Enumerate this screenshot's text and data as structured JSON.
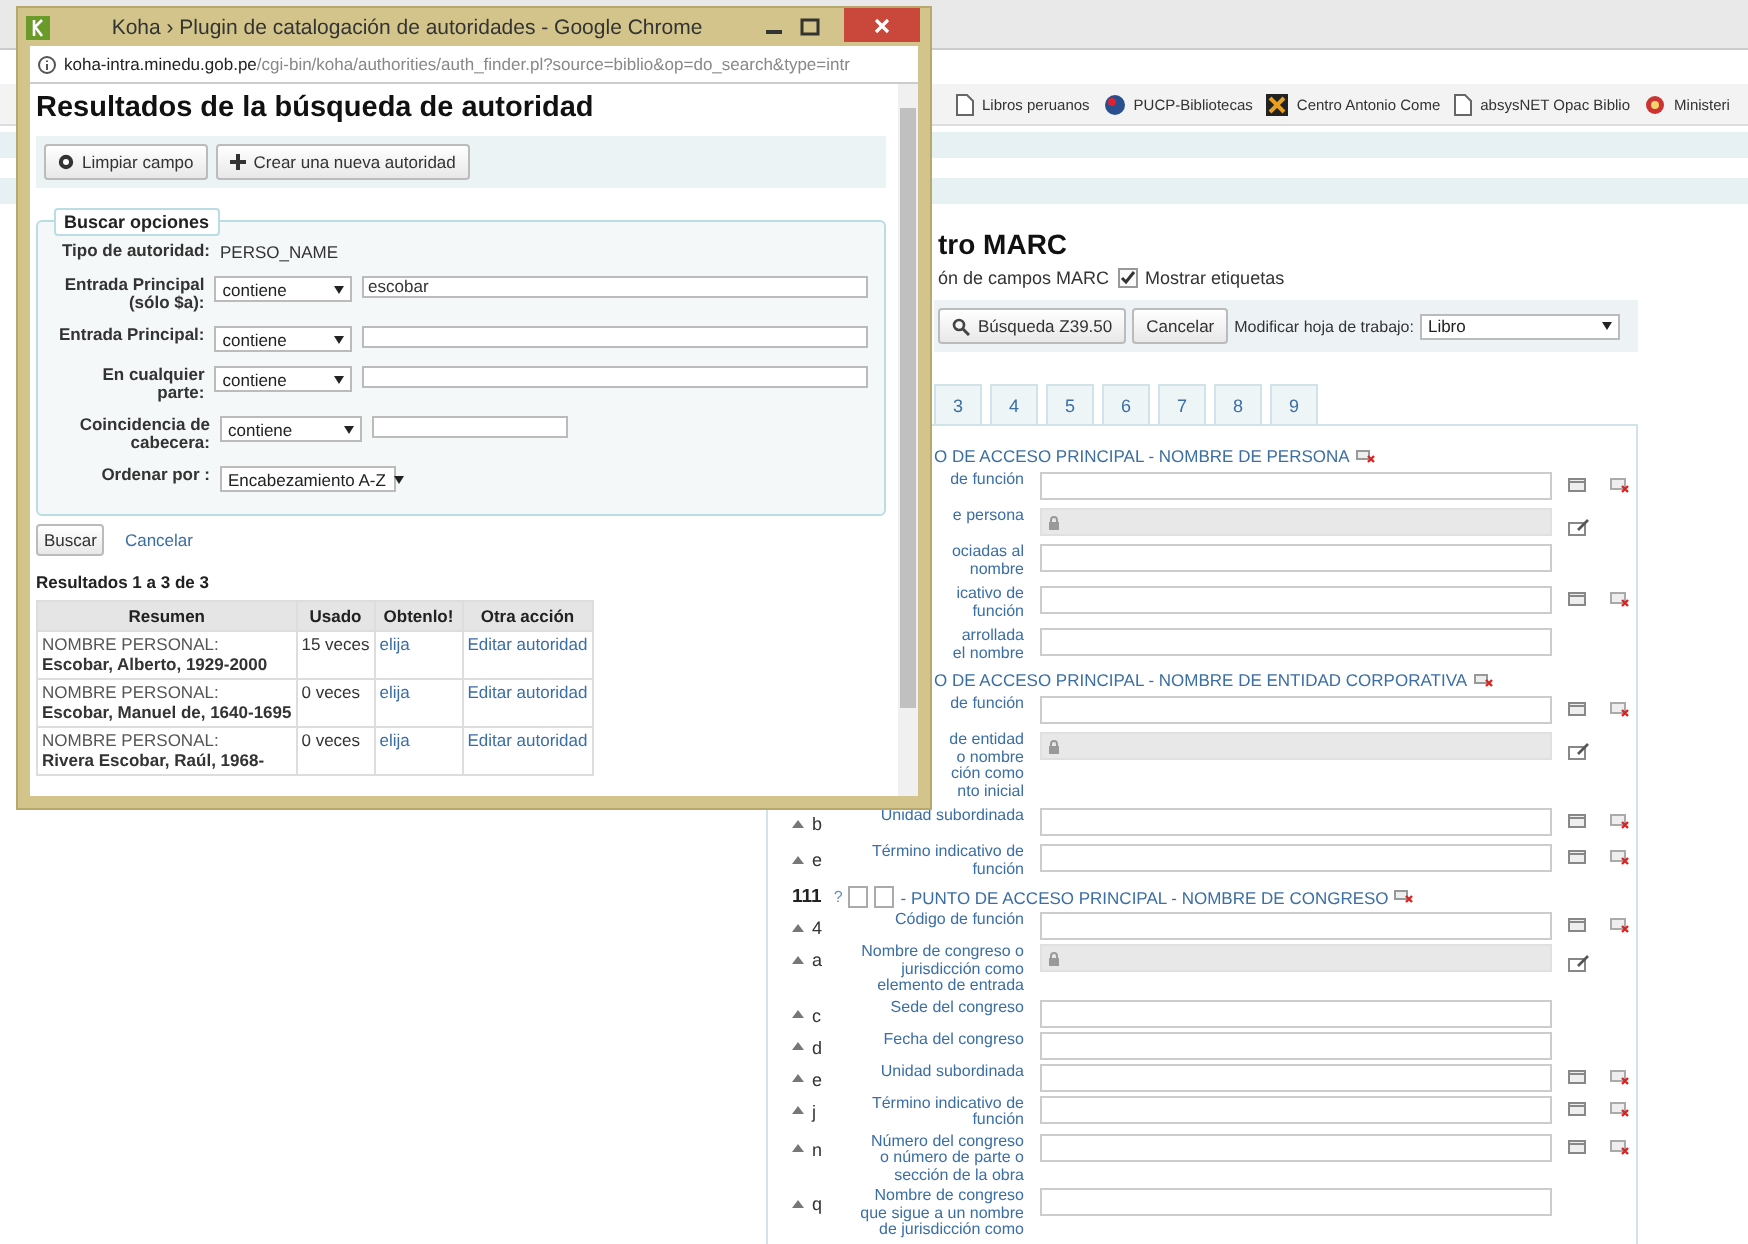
{
  "popup": {
    "title": "Koha › Plugin de catalogación de autoridades - Google Chrome",
    "url_host": "koha-intra.minedu.gob.pe",
    "url_path": "/cgi-bin/koha/authorities/auth_finder.pl?source=biblio&op=do_search&type=intr",
    "heading": "Resultados de la búsqueda de autoridad",
    "toolbar_buttons": [
      {
        "label": "Limpiar campo"
      },
      {
        "label": "Crear una nueva autoridad"
      }
    ],
    "search_options": {
      "legend": "Buscar opciones",
      "type_label": "Tipo de autoridad:",
      "type_value": "PERSO_NAME",
      "fields": [
        {
          "label": "Entrada Principal\n(sólo $a):",
          "operator": "contiene",
          "value": "escobar",
          "kind": "long"
        },
        {
          "label": "Entrada Principal:",
          "operator": "contiene",
          "kind": "long"
        },
        {
          "label": "En cualquier\nparte:",
          "operator": "contiene",
          "kind": "long"
        },
        {
          "label": "Coincidencia de\ncabecera:",
          "operator": "contiene",
          "kind": "short"
        }
      ],
      "sort_label": "Ordenar por :",
      "sort_value": "Encabezamiento A-Z"
    },
    "search_button": "Buscar",
    "cancel_link": "Cancelar",
    "results_summary": "Resultados 1 a 3 de 3",
    "results": {
      "columns": [
        "Resumen",
        "Usado",
        "Obtenlo!",
        "Otra acción"
      ],
      "rows": [
        {
          "type": "NOMBRE PERSONAL:",
          "name": "Escobar, Alberto, 1929-2000",
          "used": "15 veces",
          "choose": "elija",
          "edit": "Editar autoridad"
        },
        {
          "type": "NOMBRE PERSONAL:",
          "name": "Escobar, Manuel de, 1640-1695",
          "used": "0 veces",
          "choose": "elija",
          "edit": "Editar autoridad"
        },
        {
          "type": "NOMBRE PERSONAL:",
          "name": "Rivera Escobar, Raúl, 1968-",
          "used": "0 veces",
          "choose": "elija",
          "edit": "Editar autoridad"
        }
      ]
    }
  },
  "background": {
    "bookmarks": [
      {
        "label": "Libros peruanos"
      },
      {
        "label": "PUCP-Bibliotecas"
      },
      {
        "label": "Centro Antonio Come"
      },
      {
        "label": "absysNET Opac Biblio"
      },
      {
        "label": "Ministeri"
      }
    ],
    "heading": "tro MARC",
    "marc_note": "ón de campos MARC",
    "show_tags": {
      "label": "Mostrar etiquetas",
      "checked": true
    },
    "z3950_button": "Búsqueda Z39.50",
    "cancel_button": "Cancelar",
    "worksheet_label": "Modificar hoja de trabajo:",
    "worksheet_value": "Libro",
    "tabs": [
      {
        "label": "3",
        "selected": false
      },
      {
        "label": "4",
        "selected": false
      },
      {
        "label": "5",
        "selected": false
      },
      {
        "label": "6",
        "selected": false
      },
      {
        "label": "7",
        "selected": false
      },
      {
        "label": "8",
        "selected": false
      },
      {
        "label": "9",
        "selected": false
      }
    ],
    "fields": [
      {
        "header": "O DE ACCESO PRINCIPAL - NOMBRE DE PERSONA",
        "subfields": [
          {
            "label": "de función",
            "kind": "text",
            "actions": true
          },
          {
            "label": "e persona",
            "kind": "locked",
            "actions": false
          },
          {
            "label": "ociadas al\nnombre",
            "kind": "text",
            "actions": false
          },
          {
            "label": "icativo de\nfunción",
            "kind": "text",
            "actions": true
          },
          {
            "label": "arrollada\nel nombre",
            "kind": "text",
            "actions": false
          }
        ]
      },
      {
        "header": "O DE ACCESO PRINCIPAL - NOMBRE DE ENTIDAD CORPORATIVA",
        "subfields": [
          {
            "label": "de función",
            "kind": "text",
            "actions": true
          },
          {
            "label": "de entidad\no nombre\nción como\nnto inicial",
            "kind": "locked",
            "actions": false
          },
          {
            "code": "b",
            "label": "Unidad subordinada",
            "kind": "text",
            "actions": true
          },
          {
            "code": "e",
            "label": "Término indicativo de\nfunción",
            "kind": "text",
            "actions": true
          }
        ]
      },
      {
        "tag": "111",
        "help": "?",
        "header": "- PUNTO DE ACCESO PRINCIPAL - NOMBRE DE CONGRESO",
        "subfields": [
          {
            "code": "4",
            "label": "Código de función",
            "kind": "text",
            "actions": true
          },
          {
            "code": "a",
            "label": "Nombre de congreso o\njurisdicción como\nelemento de entrada",
            "kind": "locked",
            "actions": false
          },
          {
            "code": "c",
            "label": "Sede del congreso",
            "kind": "text",
            "actions": false
          },
          {
            "code": "d",
            "label": "Fecha del congreso",
            "kind": "text",
            "actions": false
          },
          {
            "code": "e",
            "label": "Unidad subordinada",
            "kind": "text",
            "actions": true
          },
          {
            "code": "j",
            "label": "Término indicativo de\nfunción",
            "kind": "text",
            "actions": true
          },
          {
            "code": "n",
            "label": "Número del congreso\no número de parte o\nsección de la obra",
            "kind": "text",
            "actions": true
          },
          {
            "code": "q",
            "label": "Nombre de congreso\nque sigue a un nombre\nde jurisdicción como",
            "kind": "text",
            "actions": false
          }
        ]
      }
    ]
  }
}
